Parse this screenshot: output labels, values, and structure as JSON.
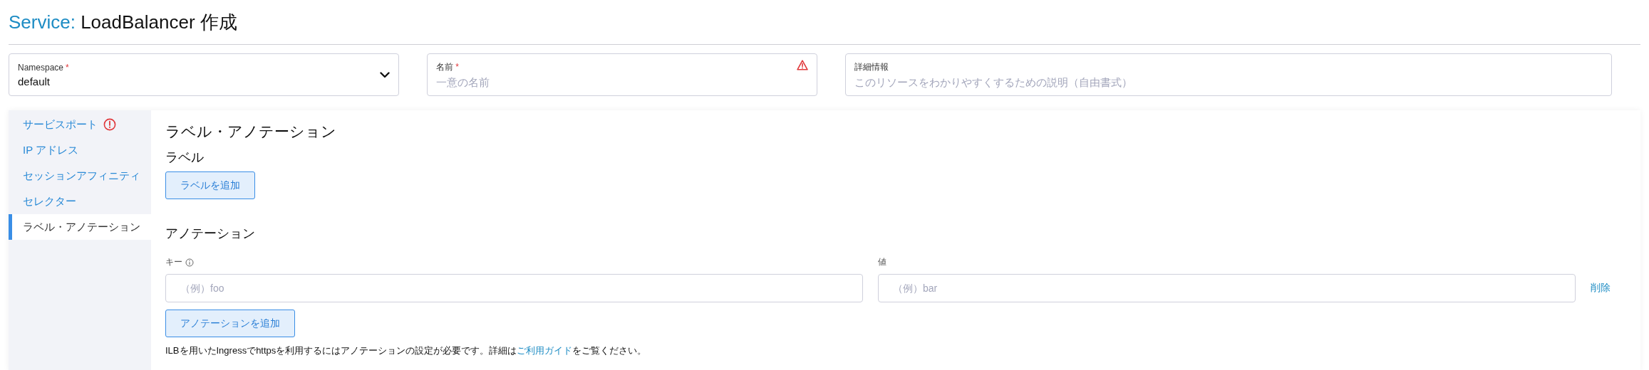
{
  "title": {
    "prefix": "Service:",
    "text": "LoadBalancer 作成"
  },
  "fields": [
    {
      "kind": "select",
      "label": "Namespace",
      "required_mark": "*",
      "value": "default",
      "error": false
    },
    {
      "kind": "text",
      "label": "名前",
      "required_mark": "*",
      "placeholder": "一意の名前",
      "error": true
    },
    {
      "kind": "text",
      "label": "詳細情報",
      "placeholder": "このリソースをわかりやすくするための説明（自由書式）",
      "error": false
    }
  ],
  "sidebar": {
    "items": [
      {
        "label": "サービスポート",
        "selected": false,
        "error": true
      },
      {
        "label": "IP アドレス",
        "selected": false,
        "error": false
      },
      {
        "label": "セッションアフィニティ",
        "selected": false,
        "error": false
      },
      {
        "label": "セレクター",
        "selected": false,
        "error": false
      },
      {
        "label": "ラベル・アノテーション",
        "selected": true,
        "error": false
      }
    ]
  },
  "section": {
    "title": "ラベル・アノテーション",
    "labels": {
      "title": "ラベル",
      "add_button": "ラベルを追加"
    },
    "annotations": {
      "title": "アノテーション",
      "key_label": "キー",
      "value_label": "値",
      "rows": [
        {
          "key_placeholder": "（例）foo",
          "value_placeholder": "（例）bar",
          "remove": "削除"
        }
      ],
      "add_button": "アノテーションを追加",
      "note": {
        "before": "ILBを用いたIngressでhttpsを利用するにはアノテーションの設定が必要です。詳細は",
        "link": "ご利用ガイド",
        "after": "をご覧ください。"
      }
    }
  }
}
